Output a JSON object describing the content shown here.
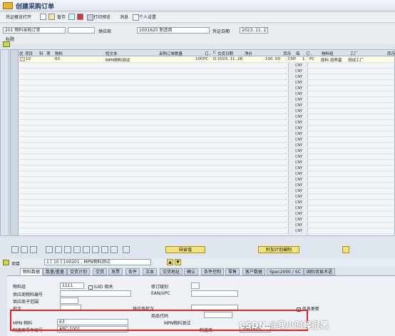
{
  "title": "创建采购订单",
  "toolbar": {
    "doc_overview": "凭证概览打开",
    "hold": "暂存",
    "print_preview": "打印预览",
    "messages": "消息",
    "personal_settings": "个人设置"
  },
  "header": {
    "order_type": "201 物料采购订单",
    "vendor_label": "供应商",
    "vendor_value": "1001625 制造商",
    "doc_date_label": "凭证日期",
    "doc_date_value": "2023. 11. 27",
    "title_toggle": "标题"
  },
  "grid": {
    "columns": [
      "状",
      "项目",
      "科",
      "项",
      "物料",
      "短文本",
      "采购订单数量",
      "订..",
      "C",
      "交货日期",
      "净价",
      "货币",
      "每",
      "订..",
      "物料组",
      "工厂",
      "库存"
    ],
    "row": {
      "item": "10",
      "material": "63",
      "short_text": "MPN物料测试",
      "qty": "100",
      "unit": "PC",
      "cat": "D",
      "delivery": "2023. 11. 28",
      "price": "100. 00",
      "currency": "CNY",
      "per": "1",
      "order_unit": "PC",
      "mat_group": "原料-培养基",
      "plant": "测试工厂"
    },
    "currency_fill": "CNY"
  },
  "buttons": {
    "default_values": "缺省值",
    "additional_planning": "附加计划编制"
  },
  "item": {
    "label": "项目",
    "selector": "1 [ 10 ] 100201 , MPN物料测试"
  },
  "tabs": [
    "物料数据",
    "数量/重量",
    "交货计划",
    "交货",
    "发票",
    "条件",
    "文本",
    "交货地址",
    "确认",
    "条件控制",
    "零售",
    "客户数据",
    "Spec2000 / SC",
    "国际贸易术语"
  ],
  "detail": {
    "mat_group_label": "物料组",
    "mat_group_value": "1111",
    "iuid_label": "IUID 相关",
    "revision_label": "修订级别",
    "vendor_mat_no_label": "供应商物料编号",
    "ean_label": "EAN/UPC",
    "vendor_subrange_label": "供应商子范围",
    "batch_label": "批次",
    "vendor_batch_label": "供应商批次",
    "info_update_label": "信息更新",
    "commodity_code_label": "商品代码",
    "mpn_mat_label": "MPN 物料",
    "mpn_mat_value": "63",
    "mpn_mat_desc": "MPN物料测试",
    "mfr_part_label": "制造商零件编号",
    "mfr_part_value": "ABC-1001",
    "mfr_label": "制造商",
    "mfr_value": "1001625"
  },
  "watermark": "CSDN @我小时候很黑"
}
